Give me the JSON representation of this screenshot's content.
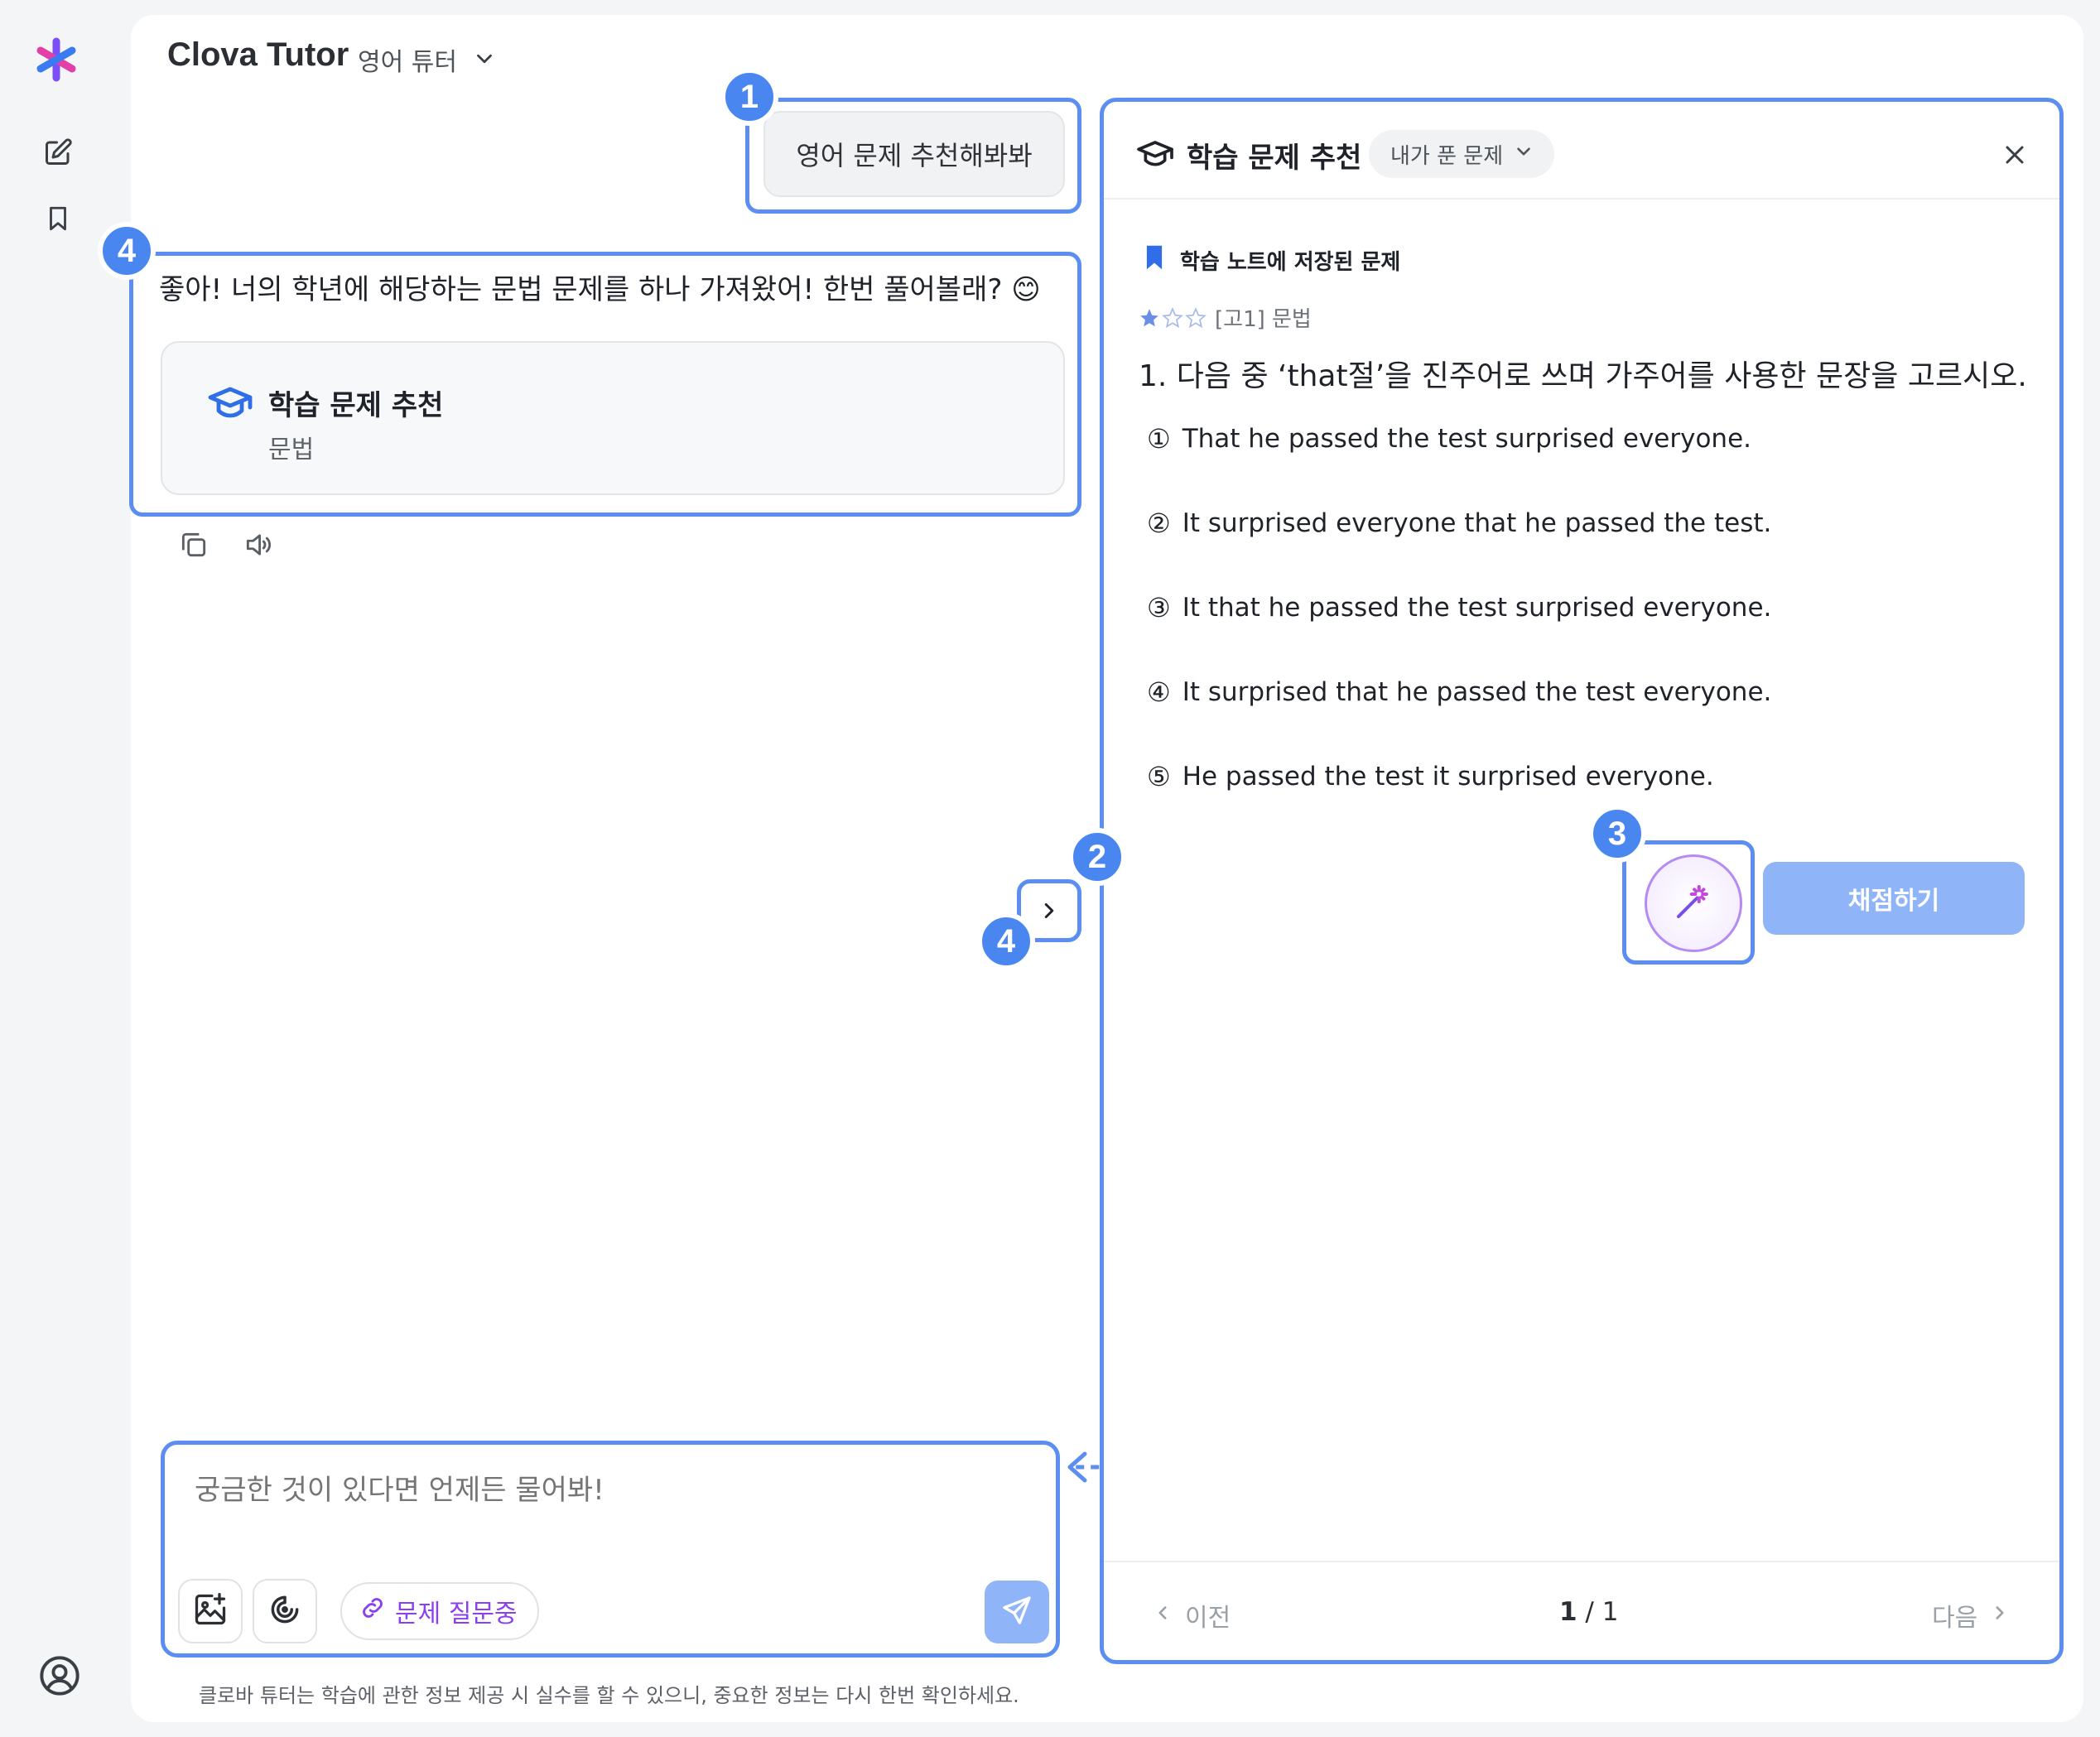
{
  "header": {
    "title": "Clova Tutor",
    "subtitle": "영어 튜터"
  },
  "chat": {
    "user_message": "영어 문제 추천해봐봐",
    "bot_message": "좋아! 너의 학년에 해당하는 문법 문제를 하나 가져왔어! 한번 풀어볼래? 😊",
    "card_title": "학습 문제 추천",
    "card_subtitle": "문법"
  },
  "input": {
    "placeholder": "궁금한 것이 있다면 언제든 물어봐!",
    "chip_label": "문제 질문중",
    "disclaimer": "클로바 튜터는 학습에 관한 정보 제공 시 실수를 할 수 있으니, 중요한 정보는 다시 한번 확인하세요."
  },
  "panel": {
    "title": "학습 문제 추천",
    "filter_label": "내가 푼 문제",
    "bookmark_label": "학습 노트에 저장된 문제",
    "meta": "[고1] 문법",
    "difficulty_stars": 1,
    "difficulty_max": 3,
    "question": "1. 다음 중 ‘that절’을 진주어로 쓰며 가주어를 사용한 문장을 고르시오.",
    "options": [
      {
        "num": "①",
        "text": "That he passed the test surprised everyone."
      },
      {
        "num": "②",
        "text": "It surprised everyone that he passed the test."
      },
      {
        "num": "③",
        "text": "It that he passed the test surprised everyone."
      },
      {
        "num": "④",
        "text": "It surprised that he passed the test everyone."
      },
      {
        "num": "⑤",
        "text": "He passed the test it surprised everyone."
      }
    ],
    "grade_label": "채점하기",
    "prev_label": "이전",
    "next_label": "다음",
    "page_current": "1",
    "page_total": "1"
  },
  "annotations": {
    "b1": "1",
    "b2": "2",
    "b3": "3",
    "b4": "4"
  },
  "colors": {
    "accent": "#5b8ef0",
    "badge": "#4a86f0",
    "chip_text": "#8a3ff0",
    "grade_button": "#8fb4f7"
  },
  "icons": [
    "clova-logo-icon",
    "new-chat-icon",
    "bookmark-icon",
    "profile-icon",
    "chevron-down-icon",
    "graduation-cap-icon",
    "copy-icon",
    "speaker-icon",
    "chevron-right-icon",
    "add-image-icon",
    "clock-icon",
    "link-icon",
    "send-icon",
    "close-icon",
    "star-icon",
    "magic-wand-icon",
    "chevron-left-icon"
  ]
}
